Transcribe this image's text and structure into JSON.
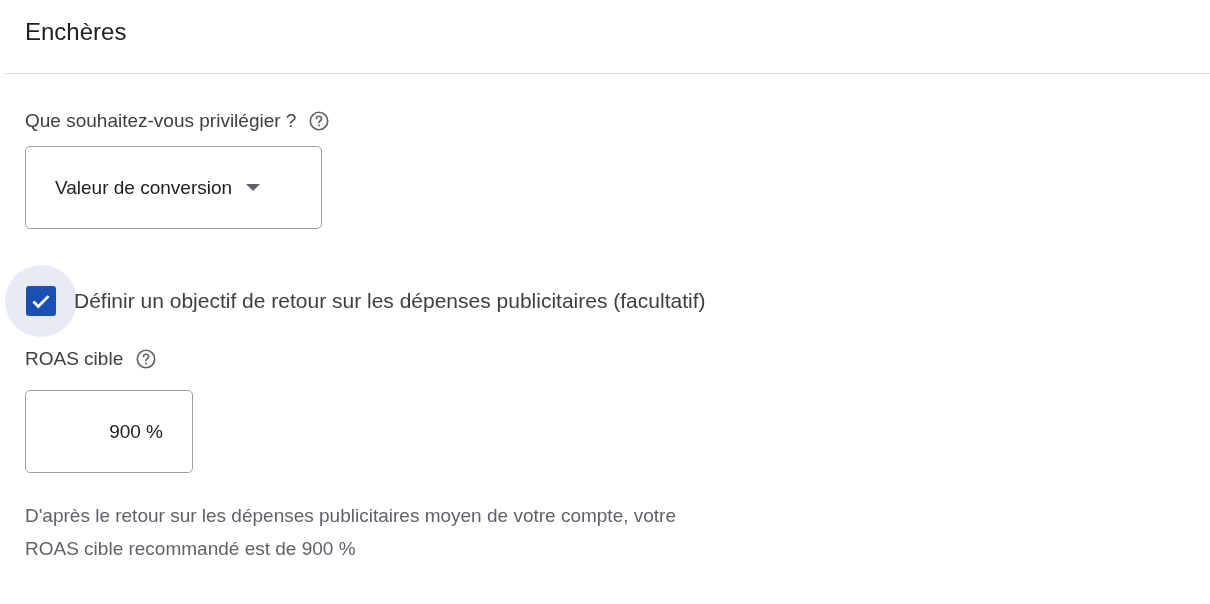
{
  "section": {
    "title": "Enchères"
  },
  "priority": {
    "label": "Que souhaitez-vous privilégier ?",
    "value": "Valeur de conversion"
  },
  "target_checkbox": {
    "label": "Définir un objectif de retour sur les dépenses publicitaires (facultatif)",
    "checked": true
  },
  "roas": {
    "label": "ROAS cible",
    "value": "900 %"
  },
  "hint": "D'après le retour sur les dépenses publicitaires moyen de votre compte, votre ROAS cible recommandé est de 900 %"
}
